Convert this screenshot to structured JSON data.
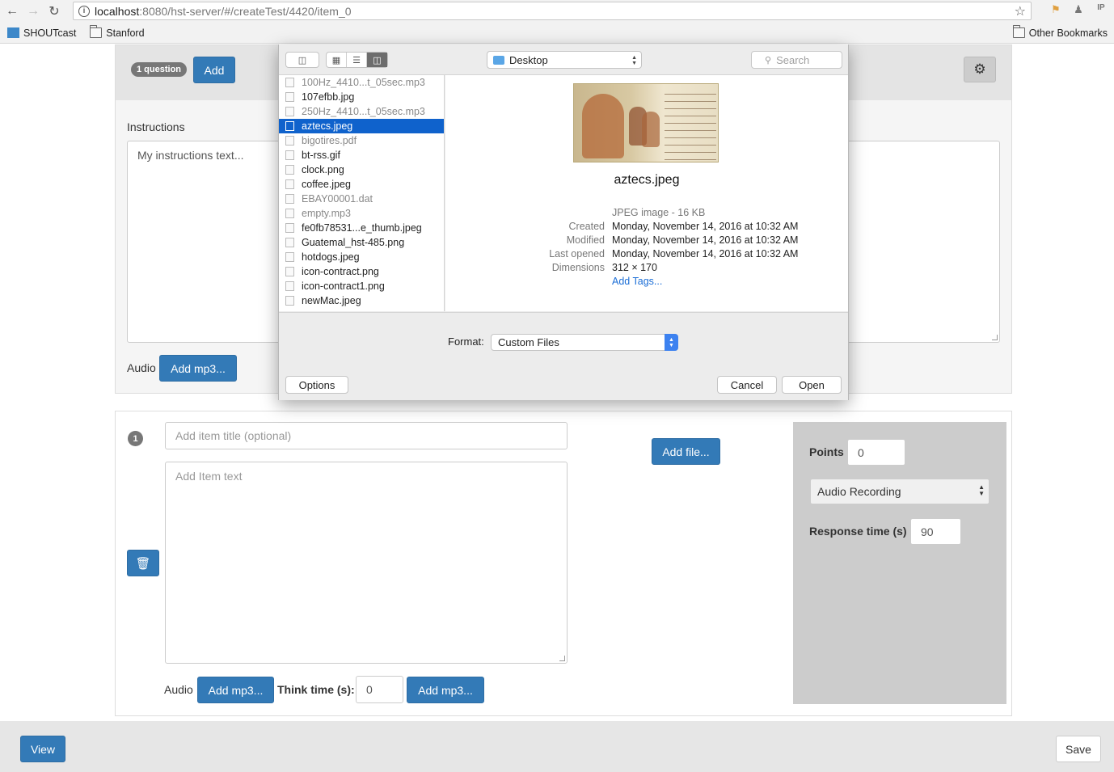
{
  "browser": {
    "url_host": "localhost",
    "url_path": ":8080/hst-server/#/createTest/4420/item_0",
    "bookmarks": [
      "SHOUTcast",
      "Stanford"
    ],
    "other_bookmarks": "Other Bookmarks"
  },
  "test_header": {
    "question_badge": "1 question",
    "add_label": "Add"
  },
  "instructions": {
    "label": "Instructions",
    "text": "My instructions text...",
    "audio_label": "Audio",
    "add_mp3_label": "Add mp3..."
  },
  "item": {
    "number": "1",
    "title_placeholder": "Add item title (optional)",
    "text_placeholder": "Add Item text",
    "add_file_label": "Add file...",
    "audio_label": "Audio",
    "add_mp3_label": "Add mp3...",
    "think_time_label": "Think time (s):",
    "think_time_value": "0",
    "add_mp3_label_2": "Add mp3...",
    "points_label": "Points",
    "points_value": "0",
    "response_type": "Audio Recording",
    "response_time_label": "Response time (s)",
    "response_time_value": "90"
  },
  "footer": {
    "view_label": "View",
    "save_label": "Save"
  },
  "file_dialog": {
    "location": "Desktop",
    "search_placeholder": "Search",
    "files": [
      {
        "name": "100Hz_4410...t_05sec.mp3",
        "dim": true
      },
      {
        "name": "107efbb.jpg",
        "dim": false
      },
      {
        "name": "250Hz_4410...t_05sec.mp3",
        "dim": true
      },
      {
        "name": "aztecs.jpeg",
        "dim": false,
        "selected": true
      },
      {
        "name": "bigotires.pdf",
        "dim": true
      },
      {
        "name": "bt-rss.gif",
        "dim": false
      },
      {
        "name": "clock.png",
        "dim": false
      },
      {
        "name": "coffee.jpeg",
        "dim": false
      },
      {
        "name": "EBAY00001.dat",
        "dim": true
      },
      {
        "name": "empty.mp3",
        "dim": true
      },
      {
        "name": "fe0fb78531...e_thumb.jpeg",
        "dim": false
      },
      {
        "name": "Guatemal_hst-485.png",
        "dim": false
      },
      {
        "name": "hotdogs.jpeg",
        "dim": false
      },
      {
        "name": "icon-contract.png",
        "dim": false
      },
      {
        "name": "icon-contract1.png",
        "dim": false
      },
      {
        "name": "newMac.jpeg",
        "dim": false
      }
    ],
    "preview": {
      "name": "aztecs.jpeg",
      "kind": "JPEG image - 16 KB",
      "created_label": "Created",
      "created": "Monday, November 14, 2016 at 10:32 AM",
      "modified_label": "Modified",
      "modified": "Monday, November 14, 2016 at 10:32 AM",
      "last_opened_label": "Last opened",
      "last_opened": "Monday, November 14, 2016 at 10:32 AM",
      "dimensions_label": "Dimensions",
      "dimensions": "312 × 170",
      "add_tags": "Add Tags..."
    },
    "format_label": "Format:",
    "format_value": "Custom Files",
    "options_label": "Options",
    "cancel_label": "Cancel",
    "open_label": "Open"
  }
}
